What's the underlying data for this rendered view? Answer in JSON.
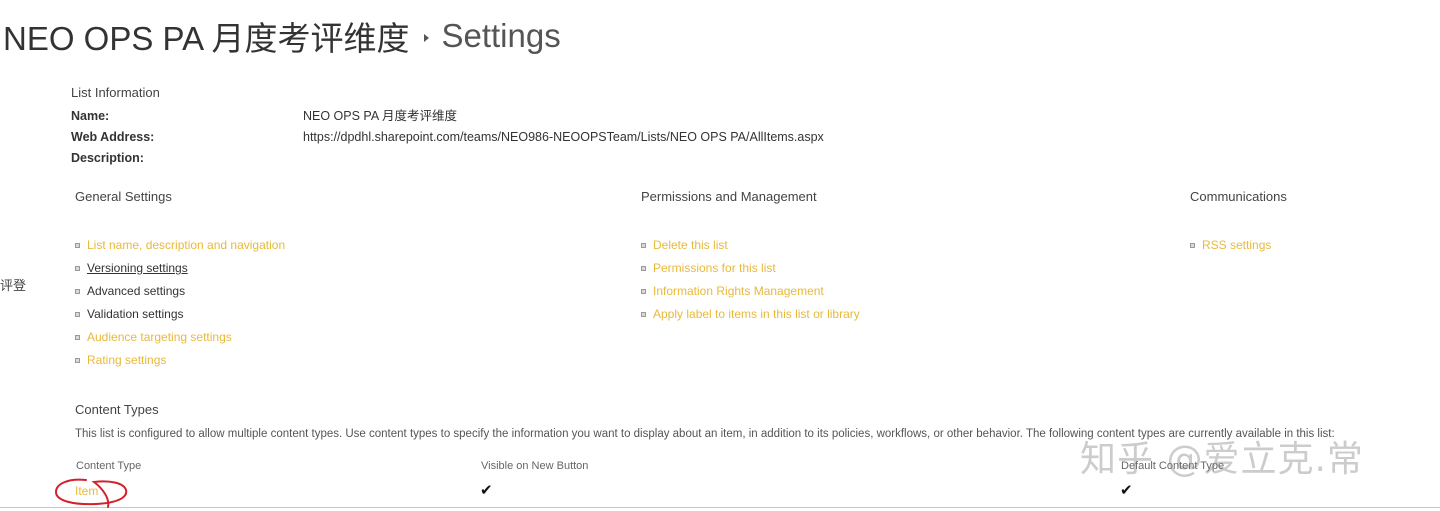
{
  "header": {
    "list_name": "NEO OPS PA 月度考评维度",
    "page_name": "Settings"
  },
  "left_nav": {
    "partial_text": "评登"
  },
  "list_information": {
    "heading": "List Information",
    "name_label": "Name:",
    "name_value": "NEO OPS PA 月度考评维度",
    "web_address_label": "Web Address:",
    "web_address_value": "https://dpdhl.sharepoint.com/teams/NEO986-NEOOPSTeam/Lists/NEO OPS PA/AllItems.aspx",
    "description_label": "Description:",
    "description_value": ""
  },
  "general_settings": {
    "heading": "General Settings",
    "items": [
      {
        "label": "List name, description and navigation"
      },
      {
        "label": "Versioning settings"
      },
      {
        "label": "Advanced settings"
      },
      {
        "label": "Validation settings"
      },
      {
        "label": "Audience targeting settings"
      },
      {
        "label": "Rating settings"
      }
    ]
  },
  "permissions_management": {
    "heading": "Permissions and Management",
    "items": [
      {
        "label": "Delete this list"
      },
      {
        "label": "Permissions for this list"
      },
      {
        "label": "Information Rights Management"
      },
      {
        "label": "Apply label to items in this list or library"
      }
    ]
  },
  "communications": {
    "heading": "Communications",
    "items": [
      {
        "label": "RSS settings"
      }
    ]
  },
  "content_types": {
    "heading": "Content Types",
    "description": "This list is configured to allow multiple content types. Use content types to specify the information you want to display about an item, in addition to its policies, workflows, or other behavior. The following content types are currently available in this list:",
    "columns": [
      "Content Type",
      "Visible on New Button",
      "Default Content Type"
    ],
    "rows": [
      {
        "name": "Item",
        "visible": "✔",
        "default": "✔"
      }
    ]
  },
  "overlay": {
    "watermark_text": "知乎 @爱立克.常"
  },
  "colors": {
    "link_accent": "#e8b93a",
    "ink_annotation": "#d4202a",
    "text": "#333333"
  }
}
